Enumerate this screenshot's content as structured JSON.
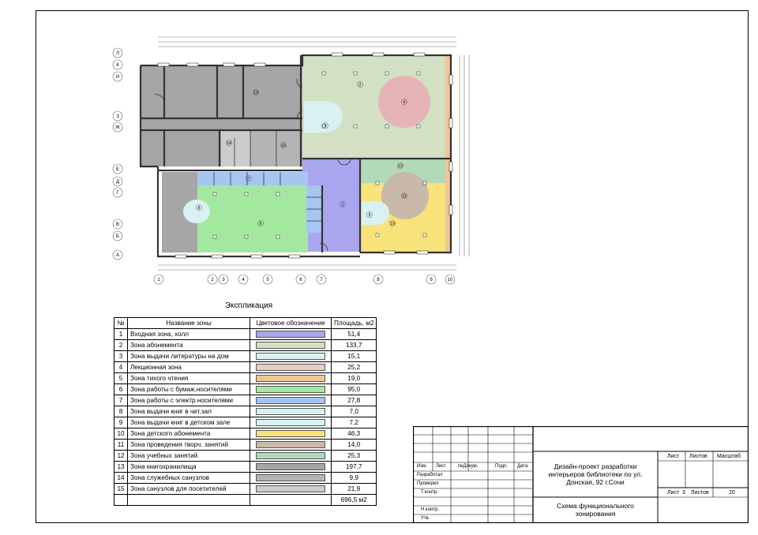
{
  "plan": {
    "axes_rows": [
      "Л",
      "К",
      "И",
      "З",
      "Ж",
      "Е",
      "Д",
      "Г",
      "В",
      "Б",
      "А"
    ],
    "axes_cols": [
      "1",
      "2",
      "3",
      "4",
      "5",
      "6",
      "7",
      "8",
      "9",
      "10"
    ],
    "room_labels": [
      "2",
      "3",
      "4",
      "6",
      "7",
      "8",
      "9",
      "10",
      "11",
      "12",
      "13",
      "14",
      "15",
      "1"
    ]
  },
  "explication": {
    "title": "Экспликация",
    "headers": [
      "№",
      "Название зоны",
      "Цветовое обозначение",
      "Площадь, м2"
    ],
    "rows": [
      {
        "n": "1",
        "name": "Входная зона, холл",
        "color": "#a9a6ef",
        "area": "51,4"
      },
      {
        "n": "2",
        "name": "Зона абонемента",
        "color": "#d3e0c3",
        "area": "133,7"
      },
      {
        "n": "3",
        "name": "Зона выдачи литературы на дом",
        "color": "#d9f1f1",
        "area": "15,1"
      },
      {
        "n": "4",
        "name": "Лекционная зона",
        "color": "#e9cdc4",
        "area": "25,2"
      },
      {
        "n": "5",
        "name": "Зона тихого чтения",
        "color": "#f1c694",
        "area": "19,0"
      },
      {
        "n": "6",
        "name": "Зона работы с бумаж.носителями",
        "color": "#a4e8a0",
        "area": "95,0"
      },
      {
        "n": "7",
        "name": "Зона работы с электр.носителями",
        "color": "#a5c6f0",
        "area": "27,8"
      },
      {
        "n": "8",
        "name": "Зона выдачи книг в чит.зал",
        "color": "#d9f1f1",
        "area": "7,0"
      },
      {
        "n": "9",
        "name": "Зона выдачи книг в детском зале",
        "color": "#d9f1f1",
        "area": "7,2"
      },
      {
        "n": "10",
        "name": "Зона детского абонемента",
        "color": "#f8e27a",
        "area": "46,3"
      },
      {
        "n": "11",
        "name": "Зона проведения творч. занятий",
        "color": "#c9b9a9",
        "area": "14,0"
      },
      {
        "n": "12",
        "name": "Зона учебных занятий",
        "color": "#b3dab8",
        "area": "25,3"
      },
      {
        "n": "13",
        "name": "Зона книгохранилища",
        "color": "#a6a6a6",
        "area": "197,7"
      },
      {
        "n": "14",
        "name": "Зона служебных санузлов",
        "color": "#b4b4b4",
        "area": "9,9"
      },
      {
        "n": "15",
        "name": "Зона санузлов для посетителей",
        "color": "#cccccc",
        "area": "21,9"
      }
    ],
    "total": "696,5 м2"
  },
  "stamp": {
    "izm": "Изм.",
    "list": "Лист",
    "ndokum": "№Докум.",
    "podp": "Подп.",
    "data": "Дата",
    "razrabotal": "Разработал",
    "proveril": "Проверил",
    "tkontr": "Т.контр.",
    "nkontr": "Н.контр.",
    "utv": "Утв.",
    "project_title": "Дизайн-проект разработки интерьеров библиотеки по ул. Донская, 92 г.Сочи",
    "sheet_title": "Схема функционального зонирования",
    "h_list": "Лист",
    "h_listov": "Листов",
    "h_masshtab": "Масштаб",
    "list_label": "Лист",
    "list_value": "3",
    "listov_label": "Листов",
    "listov_value": "20"
  }
}
